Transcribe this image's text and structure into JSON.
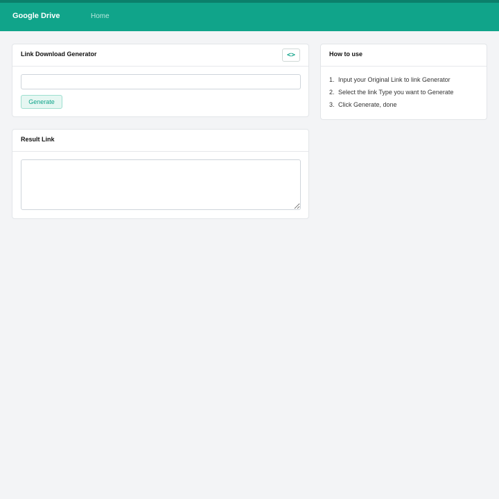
{
  "navbar": {
    "brand": "Google Drive",
    "home_label": "Home",
    "background": "#10a48a"
  },
  "generator": {
    "title": "Link Download Generator",
    "code_icon": "code-brackets-icon",
    "code_glyph": "<>",
    "input_value": "",
    "generate_label": "Generate"
  },
  "result": {
    "title": "Result Link",
    "value": ""
  },
  "howto": {
    "title": "How to use",
    "steps": [
      {
        "num": "1.",
        "text": "Input your Original Link to link Generator"
      },
      {
        "num": "2.",
        "text": "Select the link Type you want to Generate"
      },
      {
        "num": "3.",
        "text": "Click Generate, done"
      }
    ]
  },
  "colors": {
    "accent": "#10a48a",
    "page_background": "#f3f4f6"
  }
}
